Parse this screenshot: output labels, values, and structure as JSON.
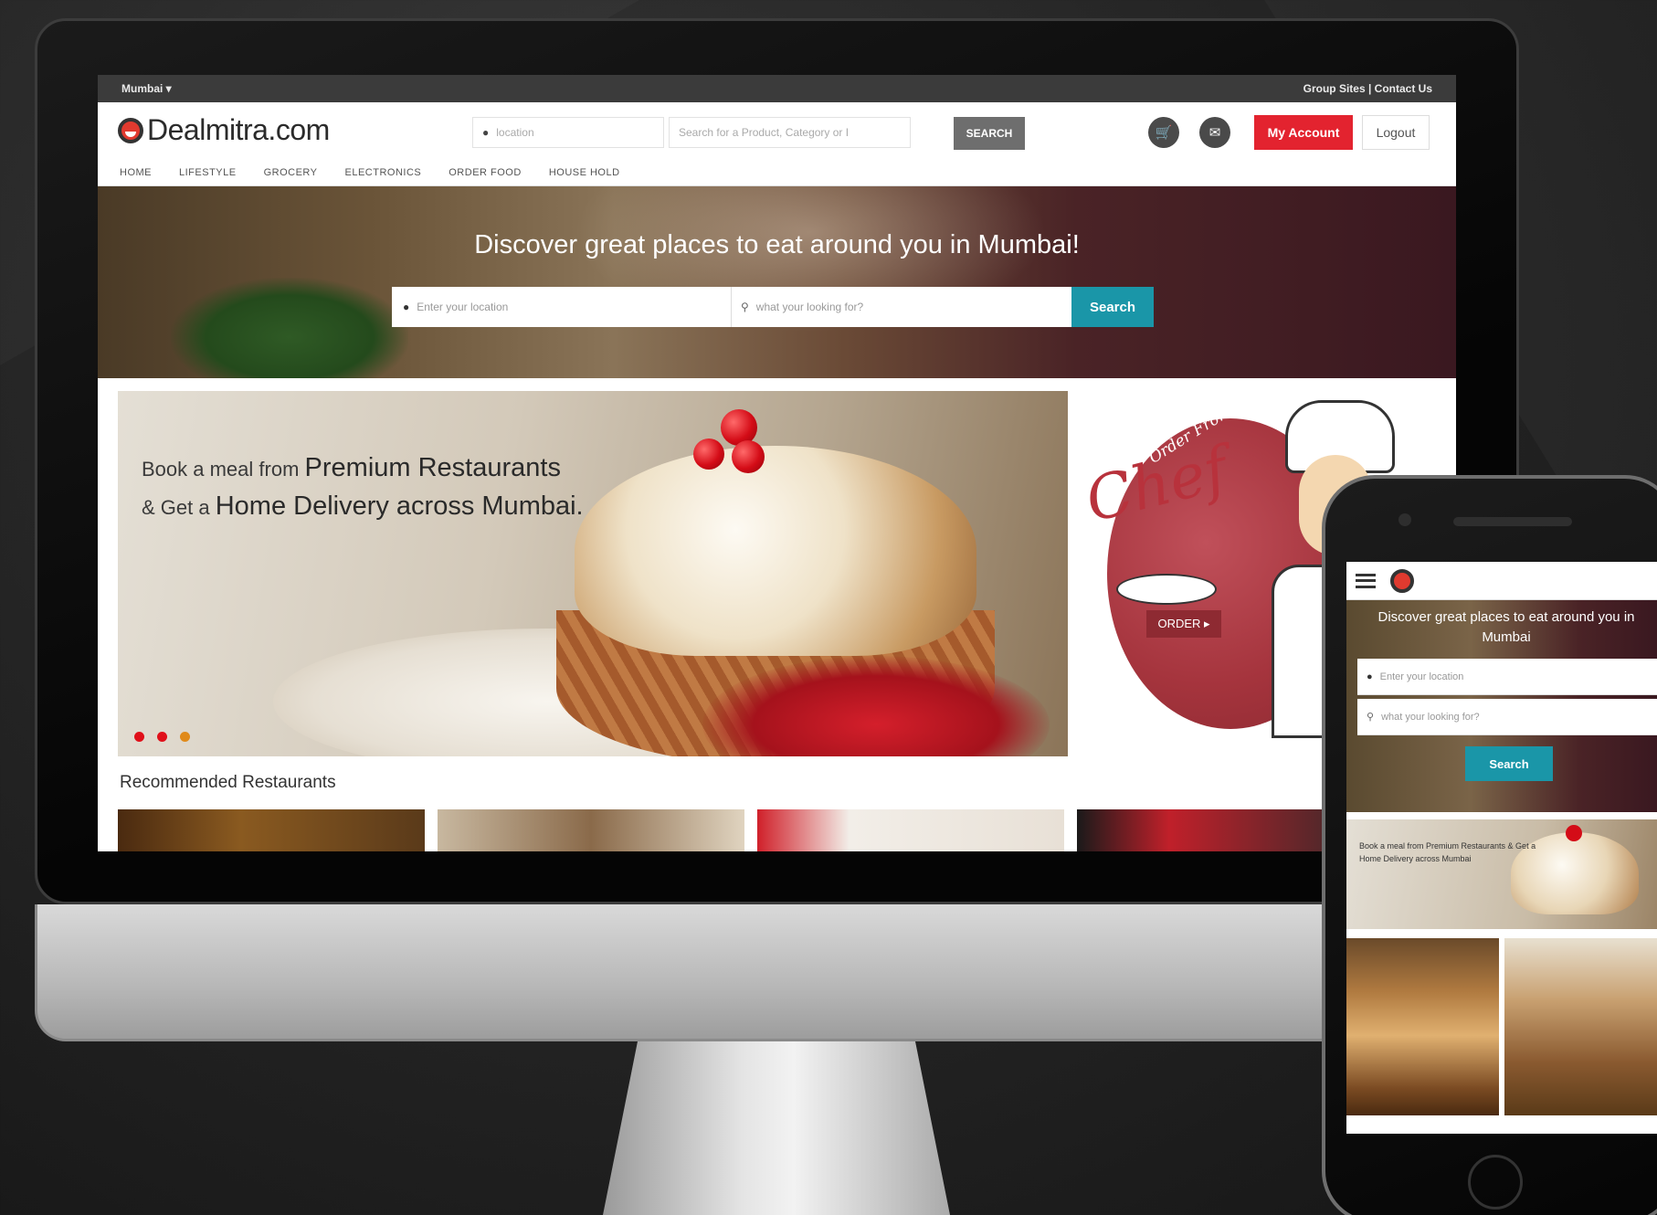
{
  "topbar": {
    "city": "Mumbai ▾",
    "links": "Group Sites | Contact Us"
  },
  "header": {
    "logo_text": "Dealmitra.com",
    "location_placeholder": "location",
    "search_placeholder": "Search for a Product, Category or I",
    "search_button": "SEARCH",
    "cart_icon": "cart-icon",
    "chat_icon": "message-icon",
    "my_account": "My Account",
    "logout": "Logout",
    "nav": [
      "HOME",
      "LIFESTYLE",
      "GROCERY",
      "ELECTRONICS",
      "ORDER FOOD",
      "HOUSE HOLD"
    ]
  },
  "hero": {
    "title": "Discover great places to eat around you in Mumbai!",
    "location_placeholder": "Enter your location",
    "what_placeholder": "what your looking for?",
    "search_button": "Search"
  },
  "promo": {
    "line1_prefix": "Book a meal from",
    "line1_emph": "Premium Restaurants",
    "line2_prefix": "& Get a",
    "line2_emph": "Home Delivery across Mumbai.",
    "slide_dots": [
      "#e0101a",
      "#e0101a",
      "#e08a1a"
    ]
  },
  "chef_banner": {
    "order_from": "Order From",
    "chef": "Chef",
    "order_button": "ORDER ▸"
  },
  "recommended": {
    "title": "Recommended Restaurants"
  },
  "mobile": {
    "hero_title": "Discover great places to eat around you in Mumbai",
    "location_placeholder": "Enter your location",
    "what_placeholder": "what your looking for?",
    "search_button": "Search",
    "promo_text": "Book a meal from Premium Restaurants & Get a Home Delivery across Mumbai"
  },
  "colors": {
    "accent_red": "#e3232f",
    "accent_teal": "#1a96a8",
    "topbar_bg": "#3b3b3b"
  }
}
